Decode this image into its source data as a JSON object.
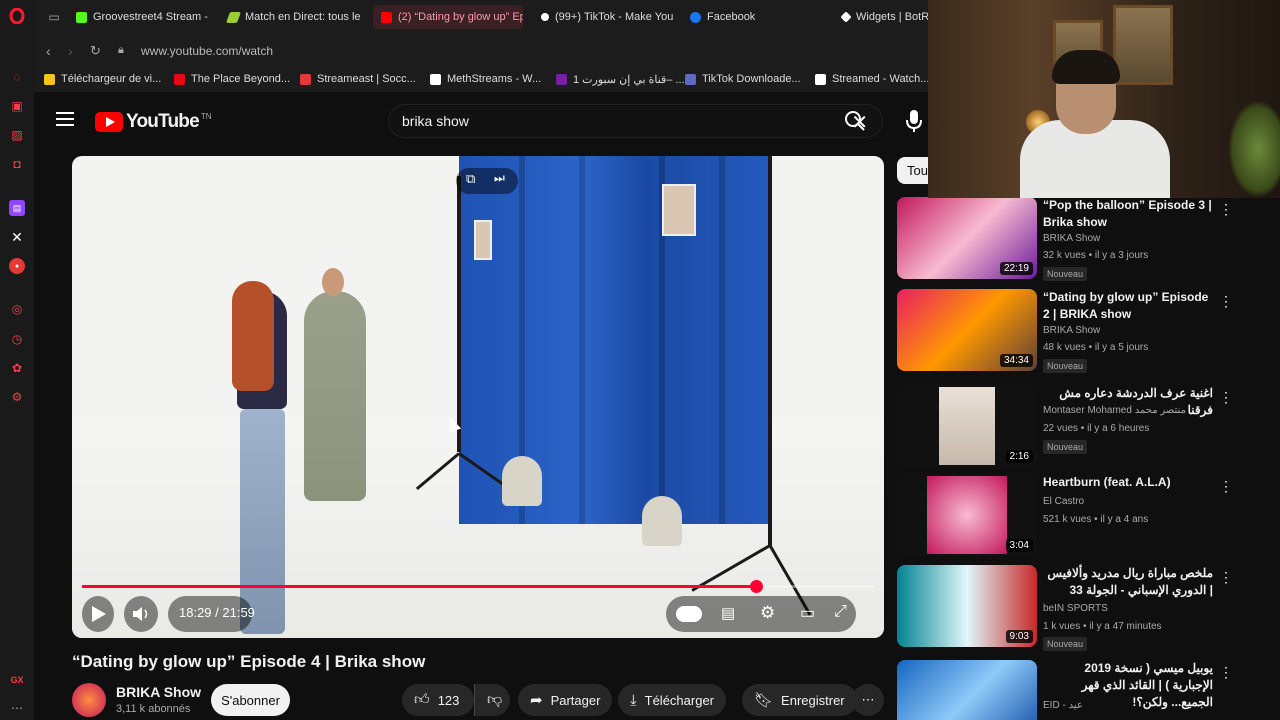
{
  "browser": {
    "tabs": [
      {
        "label": "Groovestreet4 Stream -",
        "color": "#53fc18"
      },
      {
        "label": "Match en Direct: tous le",
        "color": "#9acd32"
      },
      {
        "label": "(2) “Dating by glow up” Ep",
        "color": "#ff0000",
        "active": true
      },
      {
        "label": "(99+) TikTok - Make You",
        "color": "#ffffff"
      },
      {
        "label": "Facebook",
        "color": "#1877f2"
      },
      {
        "label": "Widgets | BotR",
        "color": "#ffffff"
      }
    ],
    "url": "www.youtube.com/watch",
    "bookmarks": [
      {
        "label": "Téléchargeur de vi...",
        "color": "#f5c518"
      },
      {
        "label": "The Place Beyond...",
        "color": "#e50914"
      },
      {
        "label": "Streameast | Socc...",
        "color": "#e53935"
      },
      {
        "label": "MethStreams - W...",
        "color": "#ffffff"
      },
      {
        "label": "قناة بي إن سبورت 1– ...",
        "color": "#7b1fa2"
      },
      {
        "label": "TikTok Downloade...",
        "color": "#5c6bc0"
      },
      {
        "label": "Streamed - Watch...",
        "color": "#ffffff"
      }
    ]
  },
  "youtube": {
    "logo_text": "YouTube",
    "country_code": "TN",
    "search_value": "brika show"
  },
  "player": {
    "progress_fraction": 0.851,
    "time_current": "18:29",
    "time_total": "21:59",
    "time_display": "18:29 / 21:59"
  },
  "video": {
    "title": "“Dating by glow up” Episode 4 | Brika show",
    "channel": "BRIKA Show",
    "subscribers": "3,11 k abonnés",
    "subscribe_label": "S'abonner",
    "likes": "123",
    "share_label": "Partager",
    "download_label": "Télécharger",
    "save_label": "Enregistrer"
  },
  "sidebar": {
    "chip": "Tous",
    "recommendations": [
      {
        "title": "“Pop the balloon” Episode 3 | Brika show",
        "channel": "BRIKA Show",
        "views": "32 k vues • il y a 3 jours",
        "badge": "Nouveau",
        "duration": "22:19",
        "thumb_color": "#c2185b"
      },
      {
        "title": "“Dating by glow up” Episode 2 | BRIKA show",
        "channel": "BRIKA Show",
        "views": "48 k vues • il y a 5 jours",
        "badge": "Nouveau",
        "duration": "34:34",
        "thumb_color": "#e91e63"
      },
      {
        "title": "اغنية عرف الدردشة دعاره مش فرقنا",
        "channel": "Montaser Mohamed منتصر محمد",
        "views": "22 vues • il y a 6 heures",
        "badge": "Nouveau",
        "duration": "2:16",
        "thumb_color": "#111111"
      },
      {
        "title": "Heartburn (feat. A.L.A)",
        "channel": "El Castro",
        "views": "521 k vues • il y a 4 ans",
        "badge": "",
        "duration": "3:04",
        "thumb_color": "#d81b60"
      },
      {
        "title": "ملخص مباراة ريال مدريد وألافيس | الدوري الإسباني - الجولة 33",
        "channel": "beIN SPORTS",
        "views": "1 k vues • il y a 47 minutes",
        "badge": "Nouveau",
        "duration": "9:03",
        "thumb_color": "#00838f"
      },
      {
        "title": "يوبيل ميسي ( نسخة 2019 الإجبارية ) | القائد الذي قهر الجميع... ولكن؟!",
        "channel": "EID - عيد",
        "views": "",
        "badge": "",
        "duration": "",
        "thumb_color": "#1565c0"
      }
    ]
  }
}
